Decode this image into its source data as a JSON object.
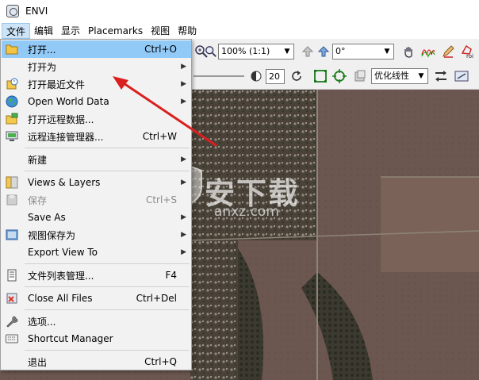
{
  "window": {
    "title": "ENVI"
  },
  "menubar": {
    "items": [
      {
        "label": "文件",
        "active": true
      },
      {
        "label": "编辑"
      },
      {
        "label": "显示"
      },
      {
        "label": "Placemarks"
      },
      {
        "label": "视图"
      },
      {
        "label": "帮助"
      }
    ]
  },
  "toolbar": {
    "zoom_select": "100% (1:1)",
    "rotation_select": "0°",
    "transparency_value": "20",
    "stretch_select": "优化线性",
    "roi_label": "roi"
  },
  "file_menu": {
    "items": [
      {
        "label": "打开...",
        "shortcut": "Ctrl+O",
        "icon": "folder-open-icon",
        "highlighted": true
      },
      {
        "label": "打开为",
        "submenu": true
      },
      {
        "label": "打开最近文件",
        "submenu": true,
        "icon": "recent-files-icon"
      },
      {
        "label": "Open World Data",
        "submenu": true,
        "icon": "globe-icon"
      },
      {
        "label": "打开远程数据...",
        "icon": "remote-data-icon"
      },
      {
        "label": "远程连接管理器...",
        "shortcut": "Ctrl+W",
        "icon": "remote-connection-icon"
      },
      {
        "label": "新建",
        "submenu": true
      },
      {
        "label": "Views & Layers",
        "submenu": true,
        "icon": "views-layers-icon"
      },
      {
        "label": "保存",
        "shortcut": "Ctrl+S",
        "disabled": true,
        "icon": "save-icon"
      },
      {
        "label": "Save As",
        "submenu": true
      },
      {
        "label": "视图保存为",
        "submenu": true,
        "icon": "save-view-icon"
      },
      {
        "label": "Export View To",
        "submenu": true
      },
      {
        "label": "文件列表管理...",
        "shortcut": "F4",
        "icon": "file-list-icon"
      },
      {
        "label": "Close All Files",
        "shortcut": "Ctrl+Del",
        "icon": "close-files-icon"
      },
      {
        "label": "选项...",
        "icon": "wrench-icon"
      },
      {
        "label": "Shortcut Manager",
        "icon": "keyboard-icon"
      },
      {
        "label": "退出",
        "shortcut": "Ctrl+Q"
      }
    ]
  },
  "watermark": {
    "text": "安下载",
    "sub": "anxz.com"
  },
  "colors": {
    "highlight": "#91c9f7",
    "annotation_arrow": "#d9201f"
  }
}
